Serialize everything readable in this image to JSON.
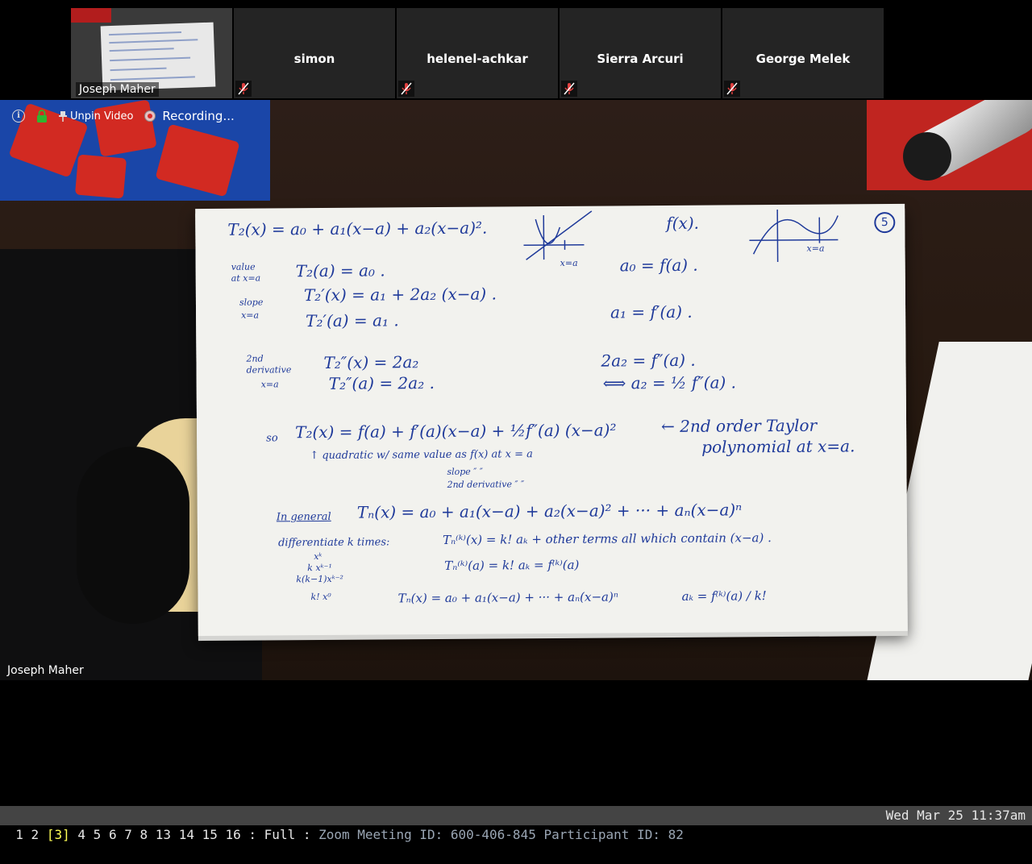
{
  "participants": {
    "self": {
      "name": "Joseph Maher"
    },
    "others": [
      {
        "name": "simon"
      },
      {
        "name": "helenel-achkar"
      },
      {
        "name": "Sierra Arcuri"
      },
      {
        "name": "George Melek"
      }
    ]
  },
  "toolbar": {
    "info_icon": "info-icon",
    "lock_icon": "lock-icon",
    "unpin_label": "Unpin Video",
    "recording_label": "Recording..."
  },
  "video": {
    "speaker_name": "Joseph Maher"
  },
  "whiteboard": {
    "page_number": "5",
    "lines": {
      "l1": "T₂(x) =   a₀ + a₁(x−a) + a₂(x−a)².",
      "l1r": "f(x).",
      "l2lab": "value",
      "l2lab2": "at x=a",
      "l2": "T₂(a)  =  a₀ .",
      "l2r": "a₀  =  f(a) .",
      "l3lab": "slope",
      "l3lab2": "x=a",
      "l3": "T₂′(x)  =   a₁ + 2a₂ (x−a) .",
      "l4": "T₂′(a)  =  a₁ .",
      "l4r": "a₁   =    f′(a) .",
      "l5lab": "2nd",
      "l5lab2": "derivative",
      "l5lab3": "x=a",
      "l5": "T₂″(x) =  2a₂",
      "l5r": "2a₂   =   f″(a) .",
      "l6": "T₂″(a)  =   2a₂ .",
      "l6r": "⟺  a₂ =  ½ f″(a) .",
      "l7so": "so",
      "l7": "T₂(x) =   f(a) + f′(a)(x−a) + ½f″(a) (x−a)²",
      "l7r": "←   2nd order Taylor",
      "l7r2": "polynomial at x=a.",
      "l8": "↑ quadratic  w/  same value as  f(x)  at  x = a",
      "l8b": "slope         ″          ″",
      "l8c": "2nd derivative  ″          ″",
      "l9lab": "In general",
      "l9": "Tₙ(x) =    a₀ + a₁(x−a) + a₂(x−a)² + ··· + aₙ(x−a)ⁿ",
      "l10lab": "differentiate  k times:",
      "l10": "Tₙ⁽ᵏ⁾(x)  =   k! aₖ +  other terms all which contain (x−a) .",
      "l11": "Tₙ⁽ᵏ⁾(a)  =   k! aₖ  =  f⁽ᵏ⁾(a)",
      "l12": "Tₙ(x)  =  a₀ + a₁(x−a) + ··· + aₙ(x−a)ⁿ",
      "l12r": "aₖ =   f⁽ᵏ⁾(a) / k!",
      "side1": "xᵏ",
      "side2": "k xᵏ⁻¹",
      "side3": "k(k−1)xᵏ⁻²",
      "side4": "k! x⁰",
      "sketch_label1": "x=a",
      "sketch_label2": "x=a"
    }
  },
  "statusbar": {
    "workspaces": [
      "1",
      "2",
      "[3]",
      "4",
      "5",
      "6",
      "7",
      "8",
      "13",
      "14",
      "15",
      "16"
    ],
    "active_workspace": "[3]",
    "layout": ": Full :",
    "window_title": "Zoom Meeting ID: 600-406-845 Participant ID: 82",
    "clock": "Wed Mar 25 11:37am"
  }
}
